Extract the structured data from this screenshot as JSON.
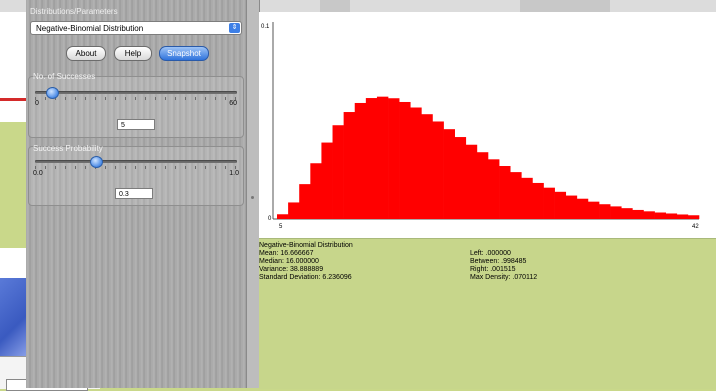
{
  "panel": {
    "title": "Distributions/Parameters",
    "distribution_selected": "Negative-Binomial Distribution",
    "buttons": {
      "about": "About",
      "help": "Help",
      "snapshot": "Snapshot"
    }
  },
  "successes": {
    "label": "No. of Successes",
    "min": "0",
    "max": "60",
    "value": "5",
    "fraction": 0.083
  },
  "probability": {
    "label": "Success Probability",
    "min": "0.0",
    "max": "1.0",
    "value": "0.3",
    "fraction": 0.3
  },
  "chart_data": {
    "type": "bar",
    "ymax_label": "0.1",
    "ymin_label": "0",
    "xmin_label": "5",
    "xmax_label": "42",
    "ylim": [
      0,
      0.1
    ],
    "bar_color": "#ff0000",
    "x": [
      5,
      6,
      7,
      8,
      9,
      10,
      11,
      12,
      13,
      14,
      15,
      16,
      17,
      18,
      19,
      20,
      21,
      22,
      23,
      24,
      25,
      26,
      27,
      28,
      29,
      30,
      31,
      32,
      33,
      34,
      35,
      36,
      37,
      38,
      39,
      40,
      41,
      42
    ],
    "values": [
      0.0024,
      0.0084,
      0.0177,
      0.0283,
      0.0388,
      0.0476,
      0.0543,
      0.0589,
      0.0614,
      0.0621,
      0.0613,
      0.0594,
      0.0566,
      0.0532,
      0.0495,
      0.0456,
      0.0416,
      0.0377,
      0.0339,
      0.0303,
      0.0269,
      0.0238,
      0.0209,
      0.0183,
      0.0159,
      0.0138,
      0.0119,
      0.0103,
      0.0088,
      0.0075,
      0.0064,
      0.0055,
      0.0046,
      0.0039,
      0.0033,
      0.0028,
      0.0023,
      0.0019
    ]
  },
  "stats": {
    "title": "Negative-Binomial Distribution",
    "mean": "Mean: 16.666667",
    "median": "Median: 16.000000",
    "variance": "Variance: 38.888889",
    "sd": "Standard Deviation: 6.236096",
    "left": "Left: .000000",
    "between": "Between: .998485",
    "right": "Right: .001515",
    "max_density": "Max Density: .070112"
  }
}
